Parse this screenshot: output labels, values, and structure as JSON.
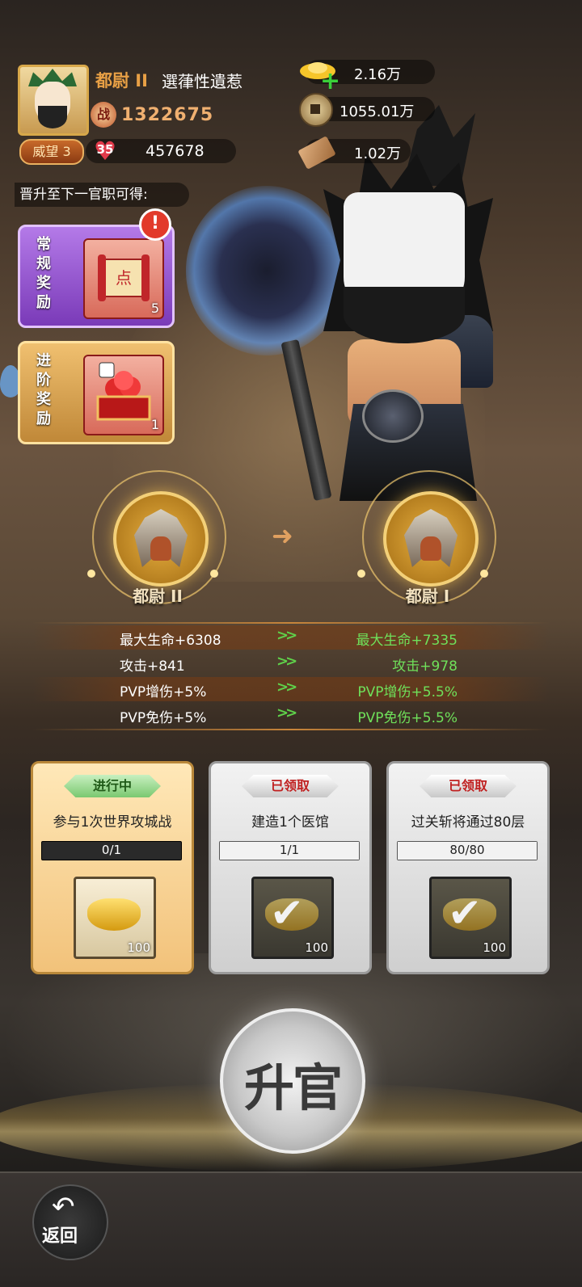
{
  "player": {
    "rank": "都尉 II",
    "name": "選葎性遺惹",
    "power_icon": "战",
    "power": "1322675",
    "prestige_label": "威望 3",
    "level": "35",
    "hp": "457678"
  },
  "resources": [
    {
      "icon": "gold-ingot-icon",
      "value": "2.16万"
    },
    {
      "icon": "copper-coin-icon",
      "value": "1055.01万"
    },
    {
      "icon": "wood-icon",
      "value": "1.02万"
    }
  ],
  "promotion_reward_label": "晋升至下一官职可得:",
  "rewards": [
    {
      "label": "常规奖励",
      "count": "5"
    },
    {
      "label": "进阶奖励",
      "count": "1"
    }
  ],
  "alert_badge": "!",
  "ranks": {
    "current": "都尉 II",
    "next": "都尉 I",
    "arrow": "➜"
  },
  "stats": [
    {
      "current": "最大生命+6308",
      "next": "最大生命+7335"
    },
    {
      "current": "攻击+841",
      "next": "攻击+978"
    },
    {
      "current": "PVP增伤+5%",
      "next": "PVP增伤+5.5%"
    },
    {
      "current": "PVP免伤+5%",
      "next": "PVP免伤+5.5%"
    }
  ],
  "stat_arrow": ">>",
  "tasks": [
    {
      "status": "进行中",
      "desc": "参与1次世界攻城战",
      "progress": "0/1",
      "progress_fraction": 0,
      "reward_count": "100"
    },
    {
      "status": "已领取",
      "desc": "建造1个医馆",
      "progress": "1/1",
      "progress_fraction": 1,
      "reward_count": "100"
    },
    {
      "status": "已领取",
      "desc": "过关斩将通过80层",
      "progress": "80/80",
      "progress_fraction": 1,
      "reward_count": "100"
    }
  ],
  "promote_button": "升官",
  "back_button": "返回",
  "colors": {
    "rank": "#e8a045",
    "stat_green": "#6fe05a",
    "claimed_tag": "#c02020"
  }
}
